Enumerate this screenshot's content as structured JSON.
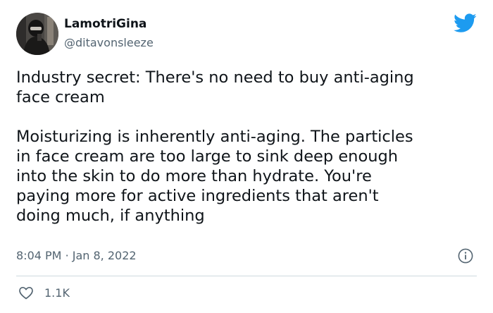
{
  "tweet": {
    "display_name": "LamotriGina",
    "handle": "@ditavonsleeze",
    "paragraphs": [
      "Industry secret: There's no need to buy anti-aging\nface cream",
      "Moisturizing is inherently anti-aging. The particles\nin face cream are too large to sink deep enough\ninto the skin to do more than hydrate. You're\npaying more for active ingredients that aren't\ndoing much, if anything"
    ],
    "time": "8:04 PM",
    "separator": "·",
    "date": "Jan 8, 2022",
    "like_count": "1.1K"
  },
  "icons": {
    "platform": "twitter-bird-icon",
    "info": "info-icon",
    "like": "heart-icon"
  },
  "colors": {
    "brand_blue": "#1d9bf0",
    "text_primary": "#0f1419",
    "text_secondary": "#536471",
    "divider": "#cfd9de"
  }
}
